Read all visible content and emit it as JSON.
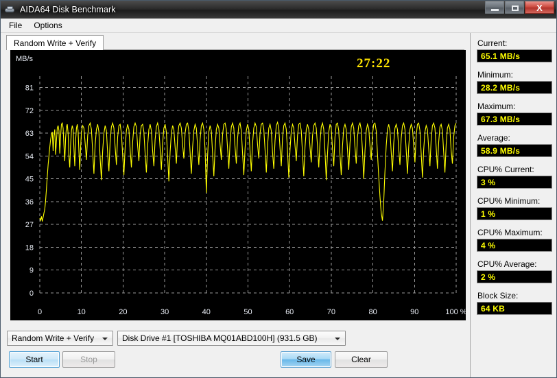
{
  "window": {
    "title": "AIDA64 Disk Benchmark",
    "icon": "disk-icon",
    "minimize_label": "",
    "maximize_label": "",
    "close_label": "X"
  },
  "menu": {
    "items": [
      {
        "label": "File"
      },
      {
        "label": "Options"
      }
    ]
  },
  "tabs": [
    {
      "label": "Random Write + Verify",
      "active": true
    }
  ],
  "chart_data": {
    "type": "line",
    "title": "",
    "timer": "27:22",
    "xlabel": "",
    "ylabel": "MB/s",
    "unit_label": "MB/s",
    "xlim": [
      0,
      100
    ],
    "ylim": [
      0,
      85.5
    ],
    "grid": true,
    "legend": "none",
    "line_color": "#ffff00",
    "background": "#000000",
    "grid_color": "#9a9a9a",
    "axis_text_color": "#e8ecf4",
    "xticks": [
      0,
      10,
      20,
      30,
      40,
      50,
      60,
      70,
      80,
      90,
      100
    ],
    "xtick_labels": [
      "0",
      "10",
      "20",
      "30",
      "40",
      "50",
      "60",
      "70",
      "80",
      "90",
      "100 %"
    ],
    "yticks": [
      0,
      9,
      18,
      27,
      36,
      45,
      54,
      63,
      72,
      81
    ],
    "ytick_labels": [
      "0",
      "9",
      "18",
      "27",
      "36",
      "45",
      "54",
      "63",
      "72",
      "81"
    ],
    "series": [
      {
        "name": "Random Write + Verify",
        "color": "#ffff00",
        "x": [
          0.0,
          0.2,
          0.4,
          0.6,
          0.8,
          1.0,
          1.2,
          1.4,
          1.6,
          1.8,
          2.0,
          2.2,
          2.4,
          2.6,
          2.8,
          3.0,
          3.2,
          3.4,
          3.6,
          3.8,
          4.0,
          4.2,
          4.4,
          4.6,
          4.8,
          5.0,
          5.2,
          5.4,
          5.6,
          5.8,
          6.0,
          6.2,
          6.4,
          6.6,
          6.8,
          7.0,
          7.2,
          7.4,
          7.6,
          7.8,
          8.0,
          8.2,
          8.4,
          8.6,
          8.8,
          9.0,
          9.2,
          9.4,
          9.6,
          9.8,
          10.0,
          10.3,
          10.6,
          10.9,
          11.2,
          11.5,
          11.8,
          12.1,
          12.4,
          12.7,
          13.0,
          13.3,
          13.6,
          13.9,
          14.2,
          14.5,
          14.8,
          15.1,
          15.4,
          15.7,
          16.0,
          16.3,
          16.6,
          16.9,
          17.2,
          17.5,
          17.8,
          18.1,
          18.4,
          18.7,
          19.0,
          19.3,
          19.6,
          19.9,
          20.2,
          20.5,
          20.8,
          21.1,
          21.4,
          21.7,
          22.0,
          22.3,
          22.6,
          22.9,
          23.2,
          23.5,
          23.8,
          24.1,
          24.4,
          24.7,
          25.0,
          25.3,
          25.6,
          25.9,
          26.2,
          26.5,
          26.8,
          27.1,
          27.4,
          27.7,
          28.0,
          28.3,
          28.6,
          28.9,
          29.2,
          29.5,
          29.8,
          30.1,
          30.4,
          30.7,
          31.0,
          31.3,
          31.6,
          31.9,
          32.2,
          32.5,
          32.8,
          33.1,
          33.4,
          33.7,
          34.0,
          34.3,
          34.6,
          34.9,
          35.2,
          35.5,
          35.8,
          36.1,
          36.4,
          36.7,
          37.0,
          37.3,
          37.6,
          37.9,
          38.2,
          38.5,
          38.8,
          39.1,
          39.4,
          39.7,
          40.0,
          40.3,
          40.6,
          40.9,
          41.2,
          41.5,
          41.8,
          42.1,
          42.4,
          42.7,
          43.0,
          43.3,
          43.6,
          43.9,
          44.2,
          44.5,
          44.8,
          45.1,
          45.4,
          45.7,
          46.0,
          46.3,
          46.6,
          46.9,
          47.2,
          47.5,
          47.8,
          48.1,
          48.4,
          48.7,
          49.0,
          49.3,
          49.6,
          49.9,
          50.2,
          50.5,
          50.8,
          51.1,
          51.4,
          51.7,
          52.0,
          52.3,
          52.6,
          52.9,
          53.2,
          53.5,
          53.8,
          54.1,
          54.4,
          54.7,
          55.0,
          55.3,
          55.6,
          55.9,
          56.2,
          56.5,
          56.8,
          57.1,
          57.4,
          57.7,
          58.0,
          58.3,
          58.6,
          58.9,
          59.2,
          59.5,
          59.8,
          60.1,
          60.4,
          60.7,
          61.0,
          61.3,
          61.6,
          61.9,
          62.2,
          62.5,
          62.8,
          63.1,
          63.4,
          63.7,
          64.0,
          64.3,
          64.6,
          64.9,
          65.2,
          65.5,
          65.8,
          66.1,
          66.4,
          66.7,
          67.0,
          67.3,
          67.6,
          67.9,
          68.2,
          68.5,
          68.8,
          69.1,
          69.4,
          69.7,
          70.0,
          70.3,
          70.6,
          70.9,
          71.2,
          71.5,
          71.8,
          72.1,
          72.4,
          72.7,
          73.0,
          73.3,
          73.6,
          73.9,
          74.2,
          74.5,
          74.8,
          75.1,
          75.4,
          75.7,
          76.0,
          76.3,
          76.6,
          76.9,
          77.2,
          77.5,
          77.8,
          78.1,
          78.4,
          78.7,
          79.0,
          79.3,
          79.6,
          79.9,
          80.2,
          80.5,
          80.8,
          81.1,
          81.4,
          81.7,
          82.0,
          82.3,
          82.6,
          82.9,
          83.2,
          83.5,
          83.8,
          84.1,
          84.4,
          84.7,
          85.0,
          85.3,
          85.6,
          85.9,
          86.2,
          86.5,
          86.8,
          87.1,
          87.4,
          87.7,
          88.0,
          88.3,
          88.6,
          88.9,
          89.2,
          89.5,
          89.8,
          90.1,
          90.4,
          90.7,
          91.0,
          91.3,
          91.6,
          91.9,
          92.2,
          92.5,
          92.8,
          93.1,
          93.4,
          93.7,
          94.0,
          94.3,
          94.6,
          94.9,
          95.2,
          95.5,
          95.8,
          96.1,
          96.4,
          96.7,
          97.0,
          97.3,
          97.6,
          97.9,
          98.2,
          98.5,
          98.8,
          99.1,
          99.4,
          99.7,
          100.0
        ],
        "y": [
          29.5,
          28.6,
          30.2,
          28.2,
          29.8,
          31.5,
          33.0,
          36.5,
          41.0,
          46.0,
          50.5,
          54.0,
          57.5,
          60.5,
          62.5,
          63.5,
          56.0,
          62.0,
          64.5,
          54.5,
          60.0,
          65.0,
          66.0,
          64.0,
          55.0,
          62.0,
          66.5,
          67.0,
          65.0,
          58.0,
          52.0,
          61.0,
          65.5,
          66.5,
          63.0,
          54.0,
          49.5,
          58.0,
          64.0,
          66.0,
          64.5,
          57.0,
          50.0,
          60.0,
          65.0,
          66.5,
          64.0,
          55.5,
          48.5,
          57.0,
          63.5,
          66.0,
          65.0,
          59.0,
          52.5,
          62.0,
          66.0,
          67.0,
          64.5,
          56.0,
          47.0,
          58.5,
          64.5,
          66.5,
          63.5,
          53.0,
          44.5,
          56.0,
          63.0,
          66.0,
          64.0,
          55.0,
          48.0,
          60.0,
          65.5,
          67.0,
          65.0,
          57.5,
          50.5,
          61.5,
          66.0,
          66.5,
          63.0,
          54.5,
          46.5,
          57.5,
          64.0,
          66.5,
          64.5,
          56.5,
          49.5,
          59.5,
          65.5,
          67.0,
          65.5,
          58.0,
          52.0,
          62.5,
          66.0,
          66.5,
          63.5,
          55.0,
          47.5,
          58.0,
          64.5,
          66.5,
          64.0,
          56.0,
          50.0,
          60.5,
          65.5,
          67.0,
          64.5,
          57.0,
          48.5,
          59.0,
          65.0,
          66.5,
          63.5,
          54.0,
          44.0,
          55.5,
          63.0,
          66.0,
          64.5,
          57.5,
          51.0,
          61.5,
          66.0,
          67.0,
          65.0,
          58.5,
          53.0,
          63.0,
          66.5,
          67.0,
          64.0,
          55.5,
          47.0,
          57.5,
          64.0,
          66.5,
          65.0,
          58.0,
          50.5,
          60.5,
          66.0,
          67.0,
          64.5,
          56.5,
          39.5,
          54.0,
          63.5,
          66.0,
          64.0,
          55.0,
          46.0,
          57.0,
          64.5,
          66.5,
          65.0,
          58.5,
          52.5,
          62.5,
          66.5,
          67.0,
          64.5,
          57.0,
          49.0,
          59.5,
          65.5,
          67.0,
          65.0,
          57.5,
          51.0,
          61.0,
          66.0,
          67.0,
          64.0,
          55.0,
          46.5,
          57.0,
          64.0,
          66.5,
          64.5,
          56.0,
          48.0,
          59.0,
          65.0,
          67.0,
          65.5,
          58.5,
          53.0,
          63.0,
          66.5,
          67.0,
          64.5,
          56.5,
          47.5,
          58.0,
          65.0,
          66.5,
          64.0,
          55.5,
          49.0,
          60.0,
          66.0,
          67.3,
          65.0,
          57.0,
          50.0,
          61.0,
          66.0,
          67.0,
          64.5,
          56.0,
          45.5,
          56.5,
          64.0,
          66.5,
          65.0,
          58.0,
          52.0,
          62.0,
          66.5,
          67.0,
          64.0,
          55.0,
          46.0,
          57.5,
          64.5,
          66.5,
          64.5,
          57.5,
          51.5,
          62.0,
          66.0,
          67.0,
          65.0,
          58.0,
          49.5,
          59.5,
          65.5,
          67.0,
          64.5,
          55.5,
          44.5,
          55.0,
          63.5,
          66.5,
          65.0,
          57.0,
          50.0,
          61.5,
          66.5,
          67.0,
          64.0,
          54.5,
          46.5,
          58.0,
          65.0,
          66.5,
          64.5,
          56.5,
          48.5,
          59.0,
          65.5,
          67.0,
          65.0,
          57.5,
          51.0,
          61.5,
          66.0,
          67.0,
          64.5,
          56.0,
          45.0,
          56.0,
          64.0,
          66.5,
          65.0,
          58.0,
          52.5,
          62.5,
          66.5,
          67.0,
          64.0,
          55.0,
          46.0,
          38.0,
          31.5,
          28.5,
          36.0,
          48.0,
          58.0,
          64.5,
          66.5,
          64.0,
          55.5,
          48.0,
          59.0,
          65.0,
          66.5,
          64.5,
          57.0,
          50.5,
          61.0,
          66.0,
          67.0,
          64.5,
          56.5,
          47.0,
          57.5,
          64.5,
          66.5,
          65.0,
          58.0,
          51.5,
          62.0,
          66.5,
          67.0,
          64.0,
          55.0,
          45.5,
          56.5,
          63.5,
          66.0,
          64.5,
          57.0,
          50.0,
          60.5,
          66.0,
          67.0,
          65.0,
          57.5,
          49.0,
          59.5,
          65.5,
          66.5,
          64.0,
          55.5,
          47.5,
          58.5,
          65.0,
          66.5,
          64.5,
          56.0,
          51.0,
          61.5,
          66.0,
          67.0,
          65.0,
          58.0,
          52.0,
          62.5,
          66.5,
          63.0,
          55.0,
          48.5,
          60.0,
          65.5,
          66.0,
          62.0
        ]
      }
    ]
  },
  "stats": [
    {
      "label": "Current:",
      "value": "65.1 MB/s",
      "name": "current"
    },
    {
      "label": "Minimum:",
      "value": "28.2 MB/s",
      "name": "minimum"
    },
    {
      "label": "Maximum:",
      "value": "67.3 MB/s",
      "name": "maximum"
    },
    {
      "label": "Average:",
      "value": "58.9 MB/s",
      "name": "average"
    },
    {
      "label": "CPU% Current:",
      "value": "3 %",
      "name": "cpu-current"
    },
    {
      "label": "CPU% Minimum:",
      "value": "1 %",
      "name": "cpu-minimum"
    },
    {
      "label": "CPU% Maximum:",
      "value": "4 %",
      "name": "cpu-maximum"
    },
    {
      "label": "CPU% Average:",
      "value": "2 %",
      "name": "cpu-average"
    },
    {
      "label": "Block Size:",
      "value": "64 KB",
      "name": "block-size"
    }
  ],
  "controls": {
    "test_select": "Random Write + Verify",
    "drive_select": "Disk Drive #1  [TOSHIBA MQ01ABD100H]  (931.5 GB)",
    "start_label": "Start",
    "stop_label": "Stop",
    "save_label": "Save",
    "clear_label": "Clear"
  },
  "colors": {
    "accent_yellow": "#ffff00",
    "timer_yellow": "#ffe400",
    "chart_bg": "#000000",
    "grid": "#9a9a9a"
  }
}
